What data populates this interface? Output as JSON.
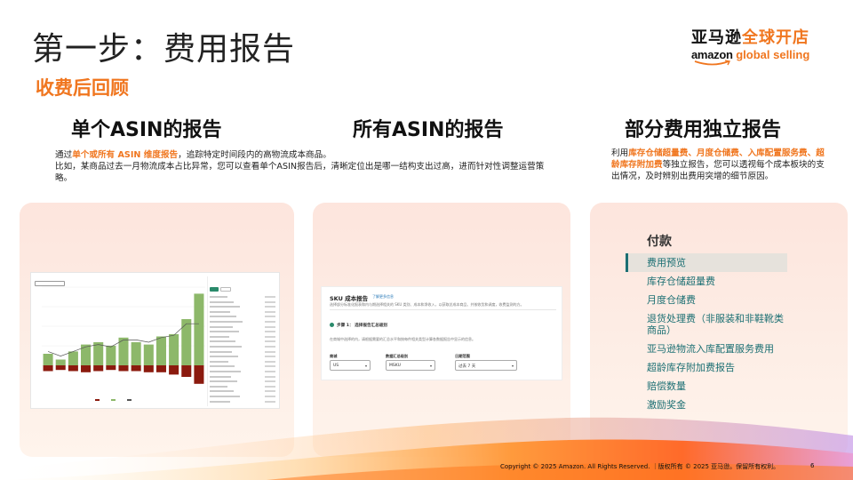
{
  "slide": {
    "title": "第一步：费用报告",
    "subtitle": "收费后回顾",
    "page_number": "6",
    "footer": "Copyright © 2025 Amazon. All Rights Reserved. ｜版权所有 © 2025 亚马逊。保留所有权利。"
  },
  "logo": {
    "cn_dark": "亚马逊",
    "cn_orange": "全球开店",
    "en_dark": "amazon",
    "en_orange": " global selling"
  },
  "columns": [
    {
      "heading": "单个ASIN的报告",
      "desc_line1_pre": "通过",
      "desc_line1_hl": "单个或所有 ASIN 维度报告",
      "desc_line1_post": "，追踪特定时间段内的高物流成本商品。",
      "desc_line2": "比如，某商品过去一月物流成本占比异常，您可以查看单个ASIN报告后，清晰定位出是哪一结构支出过高，进而针对性调整运营策略。"
    },
    {
      "heading": "所有ASIN的报告"
    },
    {
      "heading": "部分费用独立报告",
      "desc_pre": "利用",
      "desc_hl": "库存仓储超量费、月度仓储费、入库配置服务费、超龄库存附加费",
      "desc_post": "等独立报告，您可以透视每个成本板块的支出情况，及时辨别出费用突增的细节原因。"
    }
  ],
  "sku_report": {
    "title": "SKU 成本报告",
    "link": "了解更多信息",
    "intro": "选择部分标准化报表和内与期选择相关的 SKU 类别、成本和净收入，以获取总成本商品、并按收货和调度，收费监测的方。",
    "step_title": "步骤 1： 选择报告汇总级别",
    "step_desc": "在商城中选择的内，请根据需要的汇总水平和按每件相关类型计算各数据报告中显示的信息。",
    "fields": [
      {
        "label": "商城",
        "value": "US"
      },
      {
        "label": "数据汇总级别",
        "value": "MSKU"
      },
      {
        "label": "日期范围",
        "value": "过去 7 天"
      }
    ]
  },
  "payment_menu": {
    "title": "付款",
    "items": [
      {
        "label": "费用预览",
        "active": true
      },
      {
        "label": "库存仓储超量费",
        "active": false
      },
      {
        "label": "月度仓储费",
        "active": false
      },
      {
        "label": "退货处理费（非服装和非鞋靴类商品）",
        "active": false
      },
      {
        "label": "亚马逊物流入库配置服务费用",
        "active": false
      },
      {
        "label": "超龄库存附加费报告",
        "active": false
      },
      {
        "label": "赔偿数量",
        "active": false
      },
      {
        "label": "激励奖金",
        "active": false
      }
    ]
  },
  "asin_chart": {
    "colors": {
      "positive": "#8db86a",
      "negative": "#8b1a0e",
      "line": "#555555"
    },
    "bars": [
      {
        "pos": 0.1,
        "neg": 0.05
      },
      {
        "pos": 0.05,
        "neg": 0.04
      },
      {
        "pos": 0.12,
        "neg": 0.05
      },
      {
        "pos": 0.18,
        "neg": 0.06
      },
      {
        "pos": 0.2,
        "neg": 0.05
      },
      {
        "pos": 0.17,
        "neg": 0.04
      },
      {
        "pos": 0.24,
        "neg": 0.05
      },
      {
        "pos": 0.2,
        "neg": 0.05
      },
      {
        "pos": 0.18,
        "neg": 0.06
      },
      {
        "pos": 0.25,
        "neg": 0.06
      },
      {
        "pos": 0.27,
        "neg": 0.08
      },
      {
        "pos": 0.4,
        "neg": 0.1
      },
      {
        "pos": 0.62,
        "neg": 0.16
      }
    ],
    "line": [
      0.12,
      0.08,
      0.12,
      0.16,
      0.18,
      0.16,
      0.22,
      0.22,
      0.2,
      0.24,
      0.26,
      0.36,
      0.36
    ]
  },
  "theme": {
    "accent": "#f0761f",
    "teal": "#1b6f73"
  }
}
